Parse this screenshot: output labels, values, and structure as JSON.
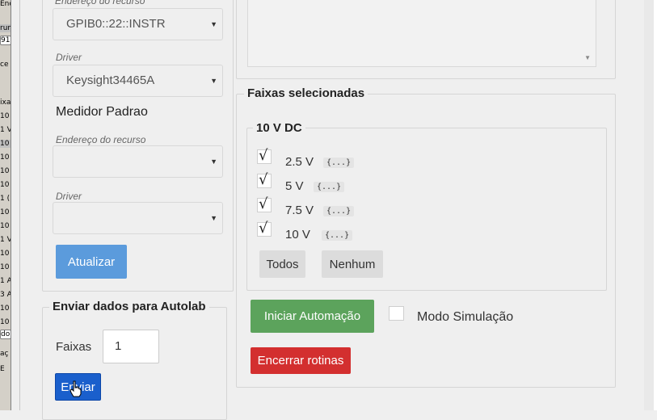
{
  "background_window": {
    "lines": [
      "Endereço do recurso fragment",
      "rum",
      "91",
      "ce",
      "ixa",
      "10",
      "1 V",
      "10",
      "10",
      "10",
      "10",
      "1 (",
      "10",
      "10",
      "1 V",
      "10",
      "10",
      "1 A",
      "3 A",
      "10",
      "10",
      "do",
      "aç",
      "E"
    ]
  },
  "left_panel": {
    "device1": {
      "resource_label": "Endereço do recurso",
      "resource_value": "GPIB0::22::INSTR",
      "driver_label": "Driver",
      "driver_value": "Keysight34465A"
    },
    "device2": {
      "title": "Medidor Padrao",
      "resource_label": "Endereço do recurso",
      "resource_value": "",
      "driver_label": "Driver",
      "driver_value": ""
    },
    "update_button": "Atualizar"
  },
  "autolab": {
    "legend": "Enviar dados para Autolab",
    "faixas_label": "Faixas",
    "faixas_value": "1",
    "send_button": "Enviar"
  },
  "ranges": {
    "legend": "Faixas selecionadas",
    "group_title": "10 V DC",
    "items": [
      {
        "label": "2.5 V",
        "tag": "{...}",
        "checked": true
      },
      {
        "label": "5 V",
        "tag": "{...}",
        "checked": true
      },
      {
        "label": "7.5 V",
        "tag": "{...}",
        "checked": true
      },
      {
        "label": "10 V",
        "tag": "{...}",
        "checked": true
      }
    ],
    "all_button": "Todos",
    "none_button": "Nenhum"
  },
  "actions": {
    "start_button": "Iniciar Automação",
    "simulation_label": "Modo Simulação",
    "stop_button": "Encerrar rotinas"
  },
  "icons": {
    "select_caret": "▼",
    "check": "√",
    "cursor": "hand-pointer"
  },
  "colors": {
    "primary": "#5b9bdc",
    "primary_active": "#1a5fcc",
    "success": "#5ca35c",
    "danger": "#d32f2f"
  }
}
